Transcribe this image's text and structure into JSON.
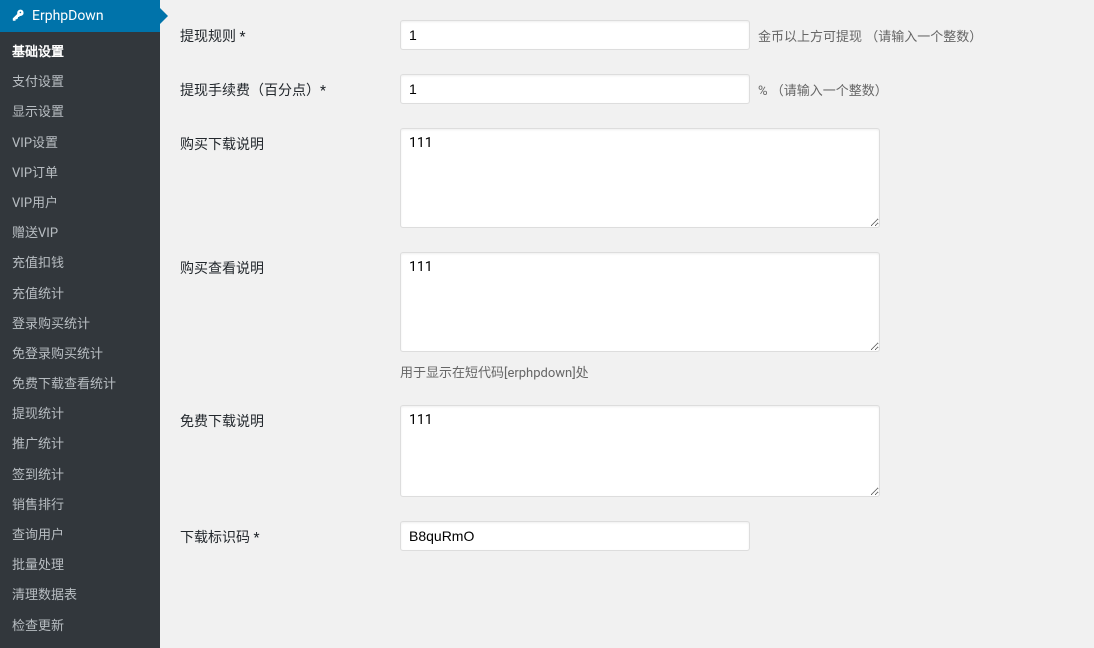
{
  "sidebar": {
    "header": "ErphpDown",
    "items": [
      {
        "label": "基础设置",
        "active": true
      },
      {
        "label": "支付设置",
        "active": false
      },
      {
        "label": "显示设置",
        "active": false
      },
      {
        "label": "VIP设置",
        "active": false
      },
      {
        "label": "VIP订单",
        "active": false
      },
      {
        "label": "VIP用户",
        "active": false
      },
      {
        "label": "赠送VIP",
        "active": false
      },
      {
        "label": "充值扣钱",
        "active": false
      },
      {
        "label": "充值统计",
        "active": false
      },
      {
        "label": "登录购买统计",
        "active": false
      },
      {
        "label": "免登录购买统计",
        "active": false
      },
      {
        "label": "免费下载查看统计",
        "active": false
      },
      {
        "label": "提现统计",
        "active": false
      },
      {
        "label": "推广统计",
        "active": false
      },
      {
        "label": "签到统计",
        "active": false
      },
      {
        "label": "销售排行",
        "active": false
      },
      {
        "label": "查询用户",
        "active": false
      },
      {
        "label": "批量处理",
        "active": false
      },
      {
        "label": "清理数据表",
        "active": false
      },
      {
        "label": "检查更新",
        "active": false
      }
    ]
  },
  "form": {
    "withdraw_rule": {
      "label": "提现规则 *",
      "value": "1",
      "hint": "金币以上方可提现 （请输入一个整数）"
    },
    "withdraw_fee": {
      "label": "提现手续费（百分点）*",
      "value": "1",
      "hint": "% （请输入一个整数）"
    },
    "buy_download_desc": {
      "label": "购买下载说明",
      "value": "111"
    },
    "buy_view_desc": {
      "label": "购买查看说明",
      "value": "111",
      "desc": "用于显示在短代码[erphpdown]处"
    },
    "free_download_desc": {
      "label": "免费下载说明",
      "value": "111"
    },
    "download_code": {
      "label": "下载标识码 *",
      "value": "B8quRmO"
    }
  }
}
